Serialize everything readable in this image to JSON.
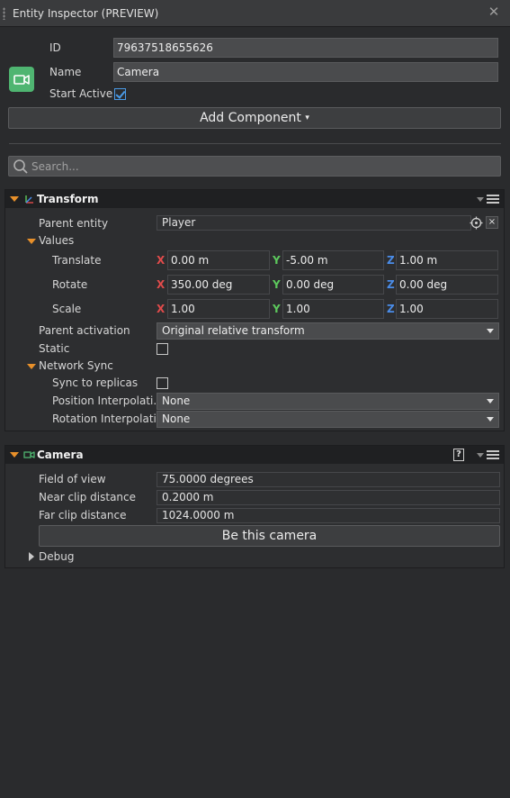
{
  "window": {
    "title": "Entity Inspector (PREVIEW)",
    "close_glyph": "✕"
  },
  "entity": {
    "id_label": "ID",
    "id_value": "79637518655626",
    "name_label": "Name",
    "name_value": "Camera",
    "start_active_label": "Start Active",
    "start_active": true,
    "icon": "camera-icon",
    "icon_color": "#4fb571"
  },
  "add_component": {
    "label": "Add Component",
    "arrow": "▾"
  },
  "search": {
    "placeholder": "Search..."
  },
  "transform": {
    "title": "Transform",
    "icon": "transform-axes-icon",
    "parent_entity_label": "Parent entity",
    "parent_entity_value": "Player",
    "values_label": "Values",
    "axis_labels": {
      "x": "X",
      "y": "Y",
      "z": "Z"
    },
    "translate": {
      "label": "Translate",
      "x": "0.00 m",
      "y": "-5.00 m",
      "z": "1.00 m"
    },
    "rotate": {
      "label": "Rotate",
      "x": "350.00 deg",
      "y": "0.00 deg",
      "z": "0.00 deg"
    },
    "scale": {
      "label": "Scale",
      "x": "1.00",
      "y": "1.00",
      "z": "1.00"
    },
    "parent_activation_label": "Parent activation",
    "parent_activation_value": "Original relative transform",
    "static_label": "Static",
    "network_sync_label": "Network Sync",
    "sync_to_replicas_label": "Sync to replicas",
    "position_interp_label": "Position Interpolati...",
    "position_interp_value": "None",
    "rotation_interp_label": "Rotation Interpolati...",
    "rotation_interp_value": "None"
  },
  "camera": {
    "title": "Camera",
    "icon": "camera-icon",
    "help_glyph": "?",
    "fov_label": "Field of view",
    "fov_value": "75.0000 degrees",
    "near_label": "Near clip distance",
    "near_value": "0.2000 m",
    "far_label": "Far clip distance",
    "far_value": "1024.0000 m",
    "be_this_camera_label": "Be this camera",
    "debug_label": "Debug"
  },
  "colors": {
    "accent_orange": "#e8902a",
    "axis_x": "#e04b4b",
    "axis_y": "#5cc85c",
    "axis_z": "#4a8ce8",
    "check_blue": "#4a9be8"
  }
}
